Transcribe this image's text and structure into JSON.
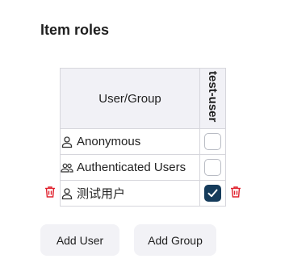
{
  "section": {
    "title": "Item roles"
  },
  "table": {
    "header_user_group": "User/Group",
    "role_columns": [
      "test-user"
    ],
    "rows": [
      {
        "name": "Anonymous",
        "icon": "user-icon",
        "checked": false,
        "removable": false
      },
      {
        "name": "Authenticated Users",
        "icon": "group-icon",
        "checked": false,
        "removable": false
      },
      {
        "name": "测试用户",
        "icon": "user-icon",
        "checked": true,
        "removable": true
      }
    ]
  },
  "buttons": {
    "add_user": "Add User",
    "add_group": "Add Group"
  },
  "colors": {
    "checked": "#153b5b",
    "danger": "#e0212d",
    "header_bg": "#f1f1f6"
  }
}
